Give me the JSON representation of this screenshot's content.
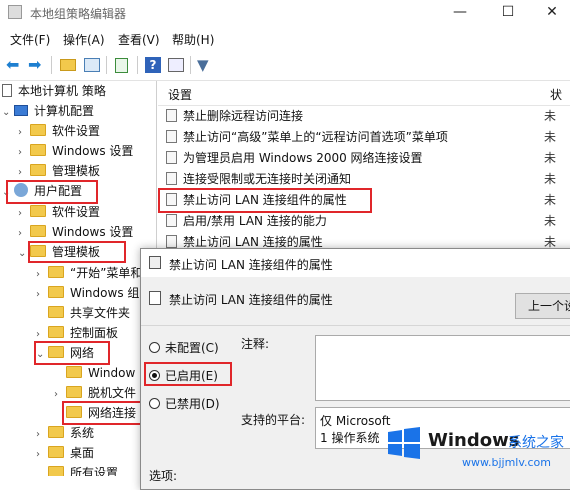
{
  "window": {
    "title": "本地组策略编辑器",
    "minimize": "—",
    "maximize": "☐",
    "close": "✕"
  },
  "menu": [
    "文件(F)",
    "操作(A)",
    "查看(V)",
    "帮助(H)"
  ],
  "toolbar": [
    "back-icon",
    "forward-icon",
    "up-folder-icon",
    "show-hide-tree-icon",
    "export-icon",
    "help-icon",
    "properties-icon",
    "filter-icon"
  ],
  "tree": {
    "root": "本地计算机 策略",
    "computer_config": "计算机配置",
    "items_computer": [
      "软件设置",
      "Windows 设置",
      "管理模板"
    ],
    "user_config": "用户配置",
    "items_user": [
      "软件设置",
      "Windows 设置",
      "管理模板"
    ],
    "admin_children": [
      "“开始”菜单和",
      "Windows 组",
      "共享文件夹",
      "控制面板",
      "网络"
    ],
    "network_children": [
      "Window",
      "脱机文件",
      "网络连接"
    ],
    "after": [
      "系统",
      "桌面",
      "所有设置"
    ]
  },
  "list": {
    "header_setting": "设置",
    "header_state": "状",
    "rows": [
      {
        "name": "禁止删除远程访问连接",
        "state": "未"
      },
      {
        "name": "禁止访问“高级”菜单上的“远程访问首选项”菜单项",
        "state": "未"
      },
      {
        "name": "为管理员启用 Windows 2000 网络连接设置",
        "state": "未"
      },
      {
        "name": "连接受限制或无连接时关闭通知",
        "state": "未"
      },
      {
        "name": "禁止访问 LAN 连接组件的属性",
        "state": "未"
      },
      {
        "name": "启用/禁用 LAN 连接的能力",
        "state": "未"
      },
      {
        "name": "禁止访问 LAN 连接的属性",
        "state": "未"
      }
    ]
  },
  "dialog": {
    "title": "禁止访问 LAN 连接组件的属性",
    "policy_name": "禁止访问 LAN 连接组件的属性",
    "prev_button": "上一个设",
    "radio_not_configured": "未配置(C)",
    "radio_enabled": "已启用(E)",
    "radio_disabled": "已禁用(D)",
    "selected": "enabled",
    "comment_label": "注释:",
    "supported_label": "支持的平台:",
    "supported_value_1": "仅 Microsoft",
    "supported_value_2": "1 操作系统",
    "options_label": "选项:"
  },
  "watermark": {
    "brand": "Windows",
    "site_cn": "系统之家",
    "url": "www.bjjmlv.com"
  },
  "colors": {
    "highlight": "#e0262a",
    "folder": "#f2c94c",
    "accent": "#1a73e8"
  }
}
